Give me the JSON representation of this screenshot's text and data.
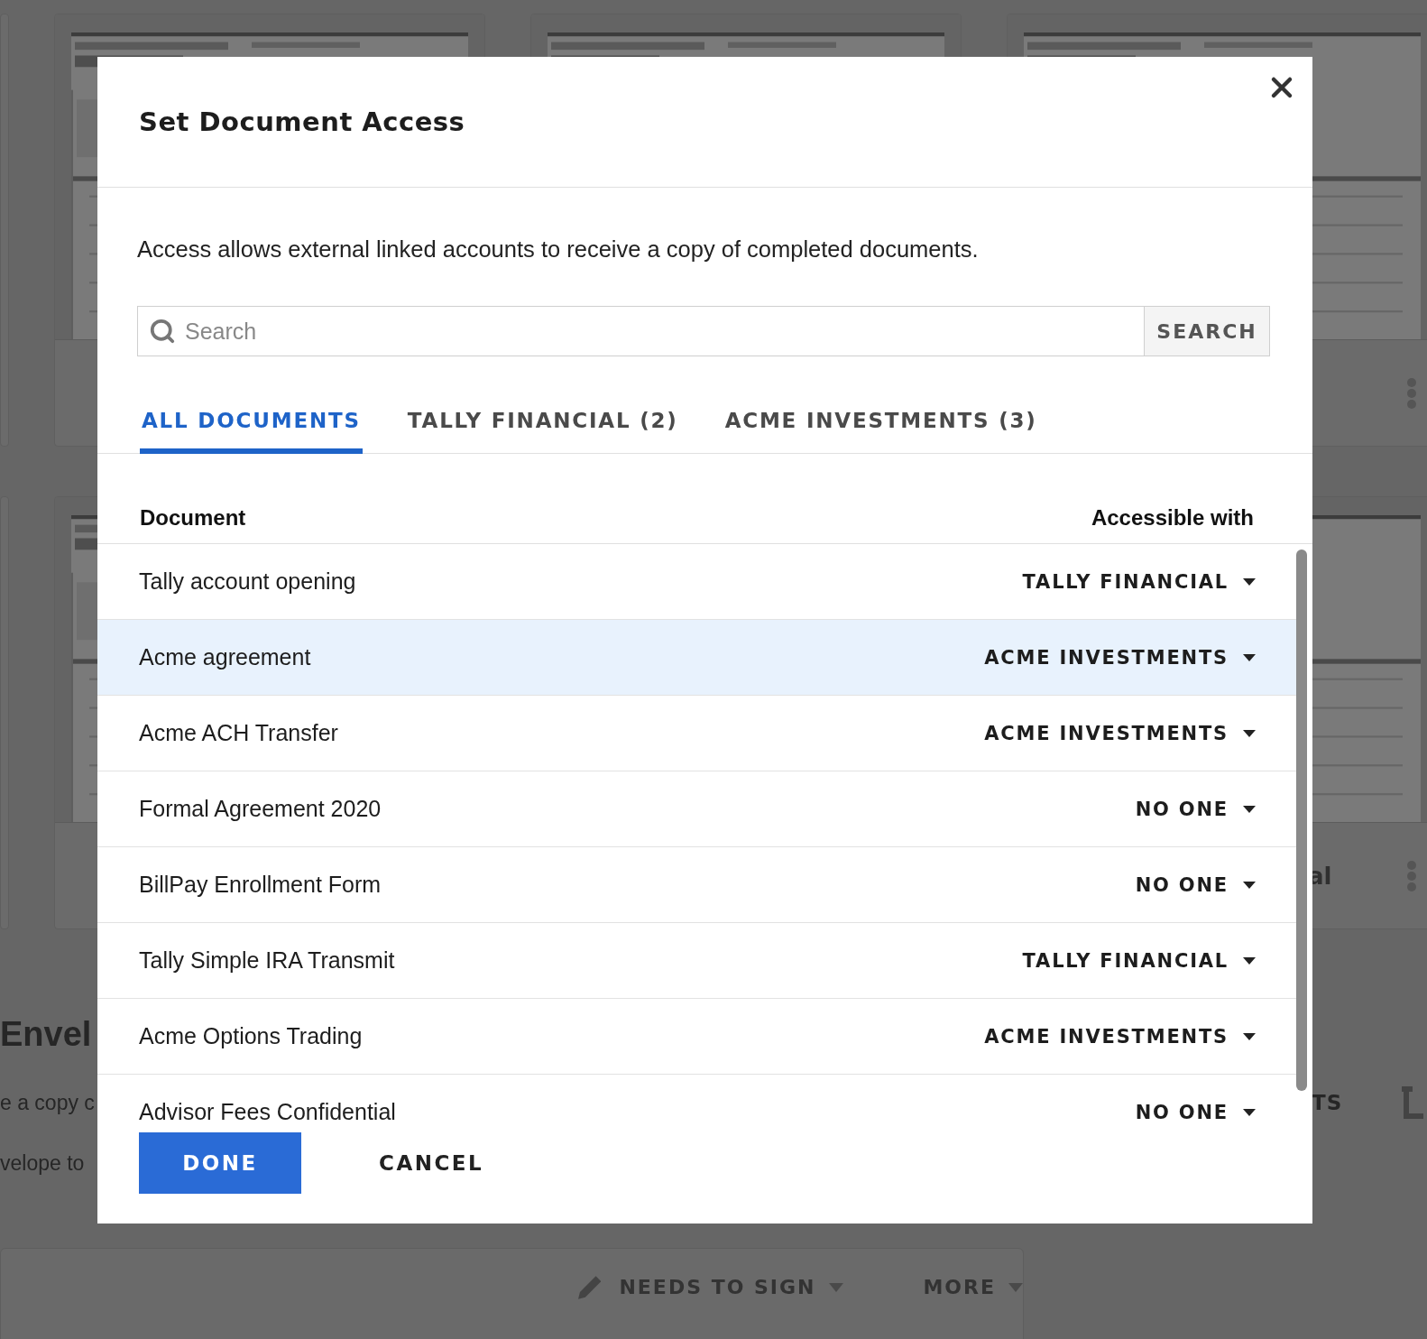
{
  "background": {
    "cards": [
      {
        "title": "al"
      }
    ],
    "section_title": "Envel",
    "section_lines": [
      "e a copy c",
      "velope to"
    ],
    "side_label": "TS",
    "envelope_actions": [
      "NEEDS TO SIGN",
      "MORE"
    ]
  },
  "dialog": {
    "title": "Set Document Access",
    "description": "Access allows external linked accounts to receive a copy of completed documents.",
    "search": {
      "placeholder": "Search",
      "button": "SEARCH"
    },
    "tabs": [
      {
        "label": "ALL DOCUMENTS",
        "selected": true
      },
      {
        "label": "TALLY FINANCIAL (2)",
        "selected": false
      },
      {
        "label": "ACME INVESTMENTS (3)",
        "selected": false
      }
    ],
    "table": {
      "columns": [
        "Document",
        "Accessible with"
      ],
      "rows": [
        {
          "document": "Tally account opening",
          "access": "TALLY FINANCIAL",
          "selected": false
        },
        {
          "document": "Acme agreement",
          "access": "ACME INVESTMENTS",
          "selected": true
        },
        {
          "document": "Acme ACH Transfer",
          "access": "ACME INVESTMENTS",
          "selected": false
        },
        {
          "document": "Formal Agreement 2020",
          "access": "NO ONE",
          "selected": false
        },
        {
          "document": "BillPay Enrollment Form",
          "access": "NO ONE",
          "selected": false
        },
        {
          "document": "Tally Simple IRA Transmit",
          "access": "TALLY FINANCIAL",
          "selected": false
        },
        {
          "document": "Acme Options Trading",
          "access": "ACME INVESTMENTS",
          "selected": false
        },
        {
          "document": "Advisor Fees Confidential",
          "access": "NO ONE",
          "selected": false
        }
      ]
    },
    "buttons": {
      "primary": "DONE",
      "secondary": "CANCEL"
    }
  }
}
